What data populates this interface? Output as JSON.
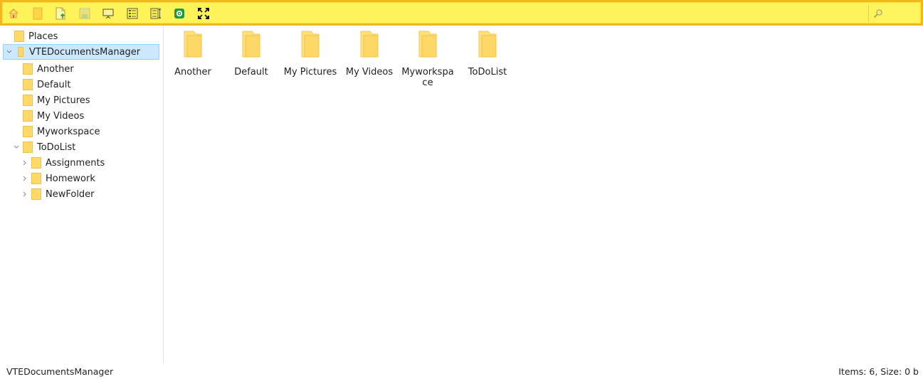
{
  "toolbar": {
    "buttons": [
      {
        "icon": "home-icon"
      },
      {
        "icon": "new-folder-icon"
      },
      {
        "icon": "upload-icon"
      },
      {
        "icon": "save-icon"
      },
      {
        "icon": "presentation-icon"
      },
      {
        "icon": "list-view-icon"
      },
      {
        "icon": "sort-icon"
      },
      {
        "icon": "settings-icon"
      },
      {
        "icon": "fullscreen-icon"
      }
    ],
    "search_placeholder": "",
    "colors": {
      "background": "#fff35a",
      "border": "#f0b81c"
    }
  },
  "tree": {
    "root_label": "Places",
    "selected_label": "VTEDocumentsManager",
    "items": [
      {
        "label": "Another"
      },
      {
        "label": "Default"
      },
      {
        "label": "My Pictures"
      },
      {
        "label": "My Videos"
      },
      {
        "label": "Myworkspace"
      },
      {
        "label": "ToDoList",
        "expanded": true
      }
    ],
    "todolist_children": [
      {
        "label": "Assignments"
      },
      {
        "label": "Homework"
      },
      {
        "label": "NewFolder"
      }
    ],
    "selected_color": "#cce8ff"
  },
  "content": {
    "folders": [
      {
        "label": "Another"
      },
      {
        "label": "Default"
      },
      {
        "label": "My Pictures"
      },
      {
        "label": "My Videos"
      },
      {
        "label": "Myworkspace"
      },
      {
        "label": "ToDoList"
      }
    ]
  },
  "status": {
    "path": "VTEDocumentsManager",
    "summary": "Items: 6, Size: 0 b"
  }
}
